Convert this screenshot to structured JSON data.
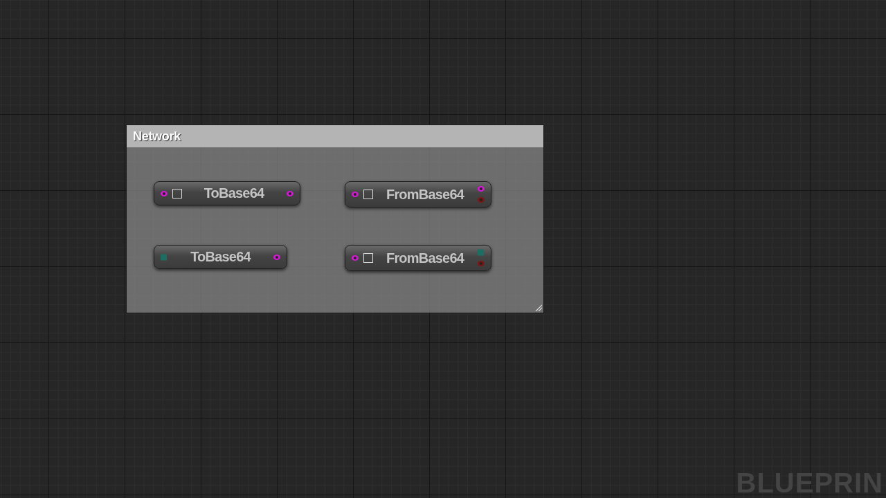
{
  "comment": {
    "title": "Network",
    "nodes": [
      {
        "title": "ToBase64",
        "inputs": [
          {
            "kind": "round",
            "color": "#d21ad2"
          }
        ],
        "checkbox": {
          "checked": false
        },
        "outputs": [
          {
            "kind": "round",
            "color": "#d21ad2"
          }
        ]
      },
      {
        "title": "FromBase64",
        "inputs": [
          {
            "kind": "round",
            "color": "#d21ad2"
          }
        ],
        "checkbox": {
          "checked": false
        },
        "outputs": [
          {
            "kind": "round",
            "color": "#d21ad2"
          },
          {
            "kind": "round",
            "color": "#7a1616"
          }
        ]
      },
      {
        "title": "ToBase64",
        "inputs": [
          {
            "kind": "square",
            "color": "#1c6e62"
          }
        ],
        "outputs": [
          {
            "kind": "round",
            "color": "#d21ad2"
          }
        ]
      },
      {
        "title": "FromBase64",
        "inputs": [
          {
            "kind": "round",
            "color": "#d21ad2"
          }
        ],
        "checkbox": {
          "checked": false
        },
        "outputs": [
          {
            "kind": "square",
            "color": "#1c6e62"
          },
          {
            "kind": "round",
            "color": "#7a1616"
          }
        ]
      }
    ]
  },
  "graph_label": "BLUEPRIN"
}
